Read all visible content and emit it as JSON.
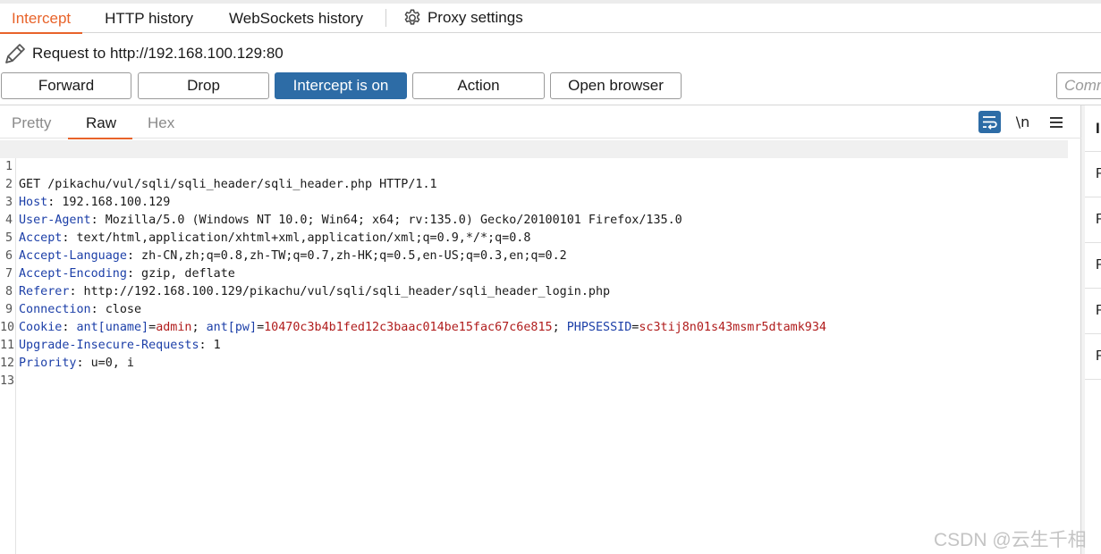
{
  "tabs": {
    "intercept": "Intercept",
    "http_history": "HTTP history",
    "websockets_history": "WebSockets history",
    "proxy_settings": "Proxy settings"
  },
  "request": {
    "label": "Request to http://192.168.100.129:80"
  },
  "buttons": {
    "forward": "Forward",
    "drop": "Drop",
    "intercept": "Intercept is on",
    "action": "Action",
    "open_browser": "Open browser"
  },
  "comment": {
    "placeholder": "Comment"
  },
  "editor": {
    "tabs": {
      "pretty": "Pretty",
      "raw": "Raw",
      "hex": "Hex"
    },
    "newline_toggle": "\\n",
    "lines": [
      {
        "num": "1",
        "text": "GET /pikachu/vul/sqli/sqli_header/sqli_header.php HTTP/1.1"
      },
      {
        "num": "2",
        "key": "Host",
        "value": ": 192.168.100.129"
      },
      {
        "num": "3",
        "key": "User-Agent",
        "value": ": Mozilla/5.0 (Windows NT 10.0; Win64; x64; rv:135.0) Gecko/20100101 Firefox/135.0"
      },
      {
        "num": "4",
        "key": "Accept",
        "value": ": text/html,application/xhtml+xml,application/xml;q=0.9,*/*;q=0.8"
      },
      {
        "num": "5",
        "key": "Accept-Language",
        "value": ": zh-CN,zh;q=0.8,zh-TW;q=0.7,zh-HK;q=0.5,en-US;q=0.3,en;q=0.2"
      },
      {
        "num": "6",
        "key": "Accept-Encoding",
        "value": ": gzip, deflate"
      },
      {
        "num": "7",
        "key": "Referer",
        "value": ": http://192.168.100.129/pikachu/vul/sqli/sqli_header/sqli_header_login.php"
      },
      {
        "num": "8",
        "key": "Connection",
        "value": ": close"
      },
      {
        "num": "9",
        "key": "Cookie",
        "value": ": ",
        "cookies": [
          {
            "name": "ant[uname]",
            "val": "admin",
            "sep": "; "
          },
          {
            "name": "ant[pw]",
            "val": "10470c3b4b1fed12c3baac014be15fac67c6e815",
            "sep": "; "
          },
          {
            "name": "PHPSESSID",
            "val": "sc3tij8n01s43msmr5dtamk934",
            "sep": ""
          }
        ]
      },
      {
        "num": "10",
        "key": "Upgrade-Insecure-Requests",
        "value": ": 1"
      },
      {
        "num": "11",
        "key": "Priority",
        "value": ": u=0, i"
      },
      {
        "num": "12",
        "text": ""
      },
      {
        "num": "13",
        "text": ""
      }
    ]
  },
  "inspector": {
    "heading": "I",
    "rows": [
      "R",
      "R",
      "R",
      "R",
      "R"
    ]
  },
  "watermark": "CSDN @云生千相",
  "colors": {
    "accent": "#e8632a",
    "intercept_on": "#2d6ca6",
    "header_key": "#1c3fa8",
    "cookie_value": "#b01c1c"
  }
}
